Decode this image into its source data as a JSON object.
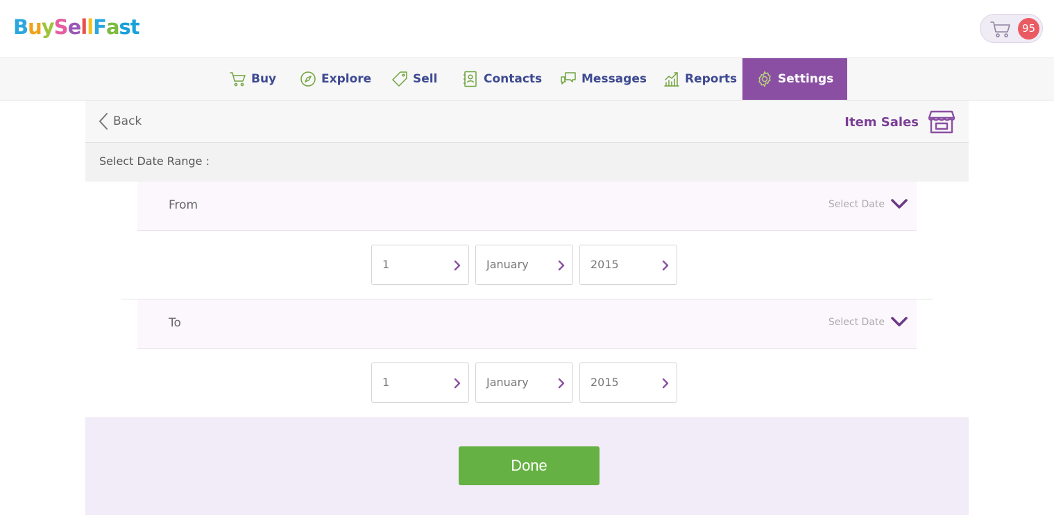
{
  "header": {
    "logo_letters": [
      "B",
      "u",
      "y",
      "S",
      "e",
      "l",
      "l",
      "F",
      "a",
      "s",
      "t"
    ],
    "logo_colors": [
      "#2aa7df",
      "#f0a31a",
      "#9dc43b",
      "#e65d9f",
      "#9b59b6",
      "#e94f4f",
      "#f3c31b",
      "#2aa7df",
      "#7dbb3f",
      "#1aa1d9",
      "#1aa1d9"
    ],
    "cart_count": "95"
  },
  "nav": {
    "items": [
      {
        "label": "Buy",
        "icon": "cart-icon"
      },
      {
        "label": "Explore",
        "icon": "compass-icon"
      },
      {
        "label": "Sell",
        "icon": "tag-icon"
      },
      {
        "label": "Contacts",
        "icon": "contacts-book-icon"
      },
      {
        "label": "Messages",
        "icon": "chat-bubbles-icon"
      },
      {
        "label": "Reports",
        "icon": "bar-chart-icon"
      },
      {
        "label": "Settings",
        "icon": "gear-icon",
        "active": true
      }
    ]
  },
  "page": {
    "back_label": "Back",
    "title": "Item Sales",
    "range_label": "Select Date Range :",
    "from": {
      "label": "From",
      "select_label": "Select Date",
      "day": "1",
      "month": "January",
      "year": "2015"
    },
    "to": {
      "label": "To",
      "select_label": "Select Date",
      "day": "1",
      "month": "January",
      "year": "2015"
    },
    "done_label": "Done"
  },
  "colors": {
    "accent": "#8a4fa3",
    "nav_text": "#3e4a92",
    "icon_green": "#6ea33d",
    "done_green": "#66b143",
    "badge_red": "#ea5a63"
  }
}
